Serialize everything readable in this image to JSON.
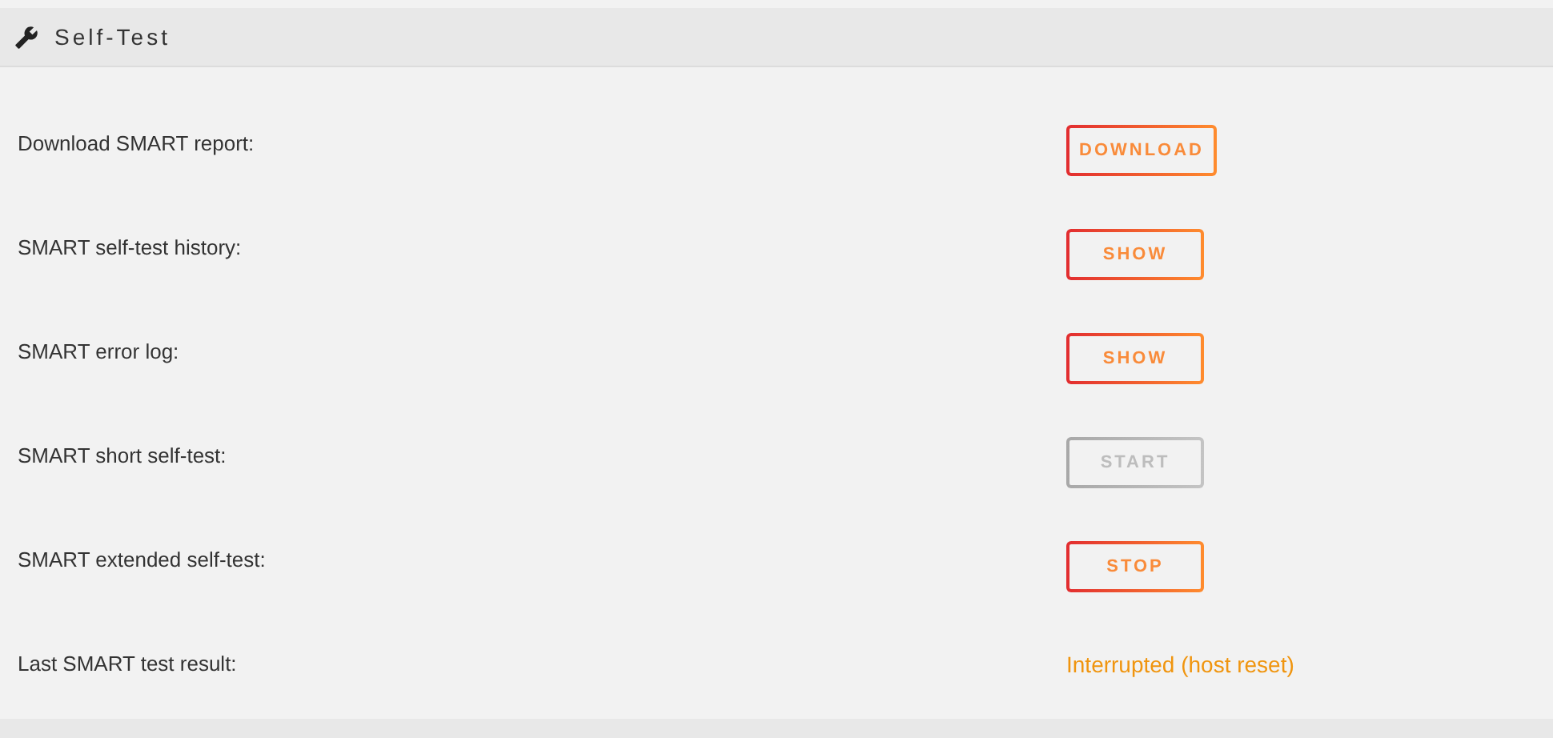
{
  "panel": {
    "title": "Self-Test"
  },
  "rows": [
    {
      "label": "Download SMART report:",
      "kind": "button",
      "text": "DOWNLOAD",
      "disabled": false
    },
    {
      "label": "SMART self-test history:",
      "kind": "button",
      "text": "SHOW",
      "disabled": false
    },
    {
      "label": "SMART error log:",
      "kind": "button",
      "text": "SHOW",
      "disabled": false
    },
    {
      "label": "SMART short self-test:",
      "kind": "button",
      "text": "START",
      "disabled": true
    },
    {
      "label": "SMART extended self-test:",
      "kind": "button",
      "text": "STOP",
      "disabled": false
    },
    {
      "label": "Last SMART test result:",
      "kind": "text",
      "text": "Interrupted (host reset)"
    }
  ]
}
